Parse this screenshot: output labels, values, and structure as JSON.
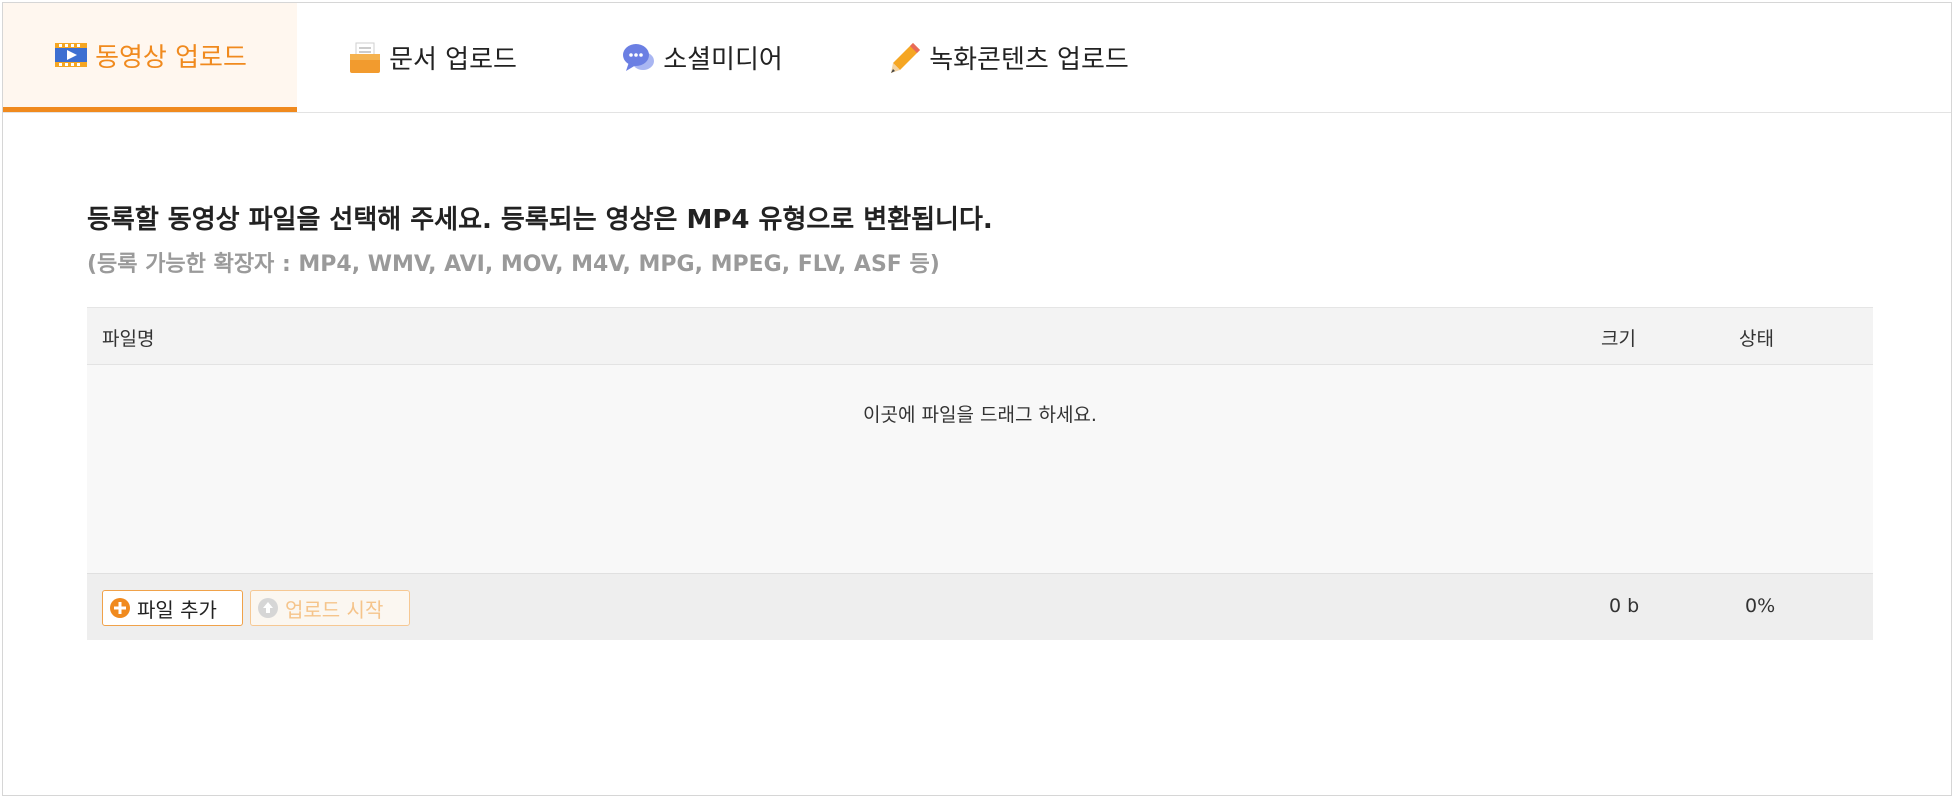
{
  "tabs": [
    {
      "label": "동영상 업로드",
      "icon": "video-icon",
      "active": true
    },
    {
      "label": "문서 업로드",
      "icon": "document-box-icon",
      "active": false
    },
    {
      "label": "소셜미디어",
      "icon": "chat-bubble-icon",
      "active": false
    },
    {
      "label": "녹화콘텐츠 업로드",
      "icon": "pencil-icon",
      "active": false
    }
  ],
  "instructions": {
    "main": "등록할 동영상 파일을 선택해 주세요. 등록되는 영상은 MP4 유형으로 변환됩니다.",
    "sub": "(등록 가능한 확장자 : MP4, WMV, AVI, MOV, M4V, MPG, MPEG, FLV, ASF 등)"
  },
  "file_table": {
    "columns": {
      "name": "파일명",
      "size": "크기",
      "status": "상태"
    },
    "dropzone_text": "이곳에 파일을 드래그 하세요.",
    "footer": {
      "add_button": "파일 추가",
      "upload_button": "업로드 시작",
      "total_size": "0 b",
      "progress": "0%"
    }
  },
  "colors": {
    "accent": "#f08a1e",
    "active_tab_bg": "#fff7ef",
    "muted_text": "#9a9a9a",
    "table_bg": "#f7f7f7"
  }
}
